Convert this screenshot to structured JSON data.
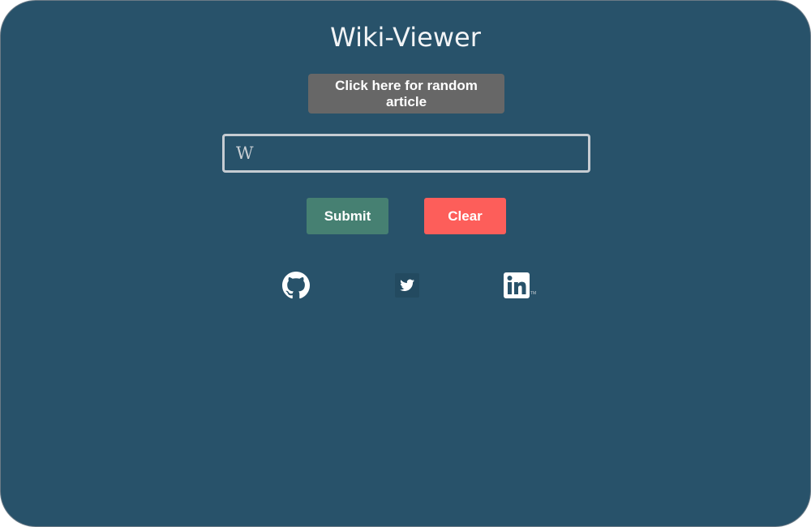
{
  "app": {
    "title": "Wiki-Viewer"
  },
  "random_button": {
    "label": "Click here for random article"
  },
  "search": {
    "icon_glyph": "W",
    "icon": "wikipedia-icon",
    "value": "",
    "placeholder": ""
  },
  "actions": {
    "submit_label": "Submit",
    "clear_label": "Clear"
  },
  "social": {
    "items": [
      {
        "name": "github-icon"
      },
      {
        "name": "twitter-icon"
      },
      {
        "name": "linkedin-icon",
        "tm": "TM"
      }
    ]
  },
  "colors": {
    "background": "#28526a",
    "random_button": "#676767",
    "submit_button": "#468072",
    "clear_button": "#fd5e5a",
    "text": "#f2f4f6"
  }
}
